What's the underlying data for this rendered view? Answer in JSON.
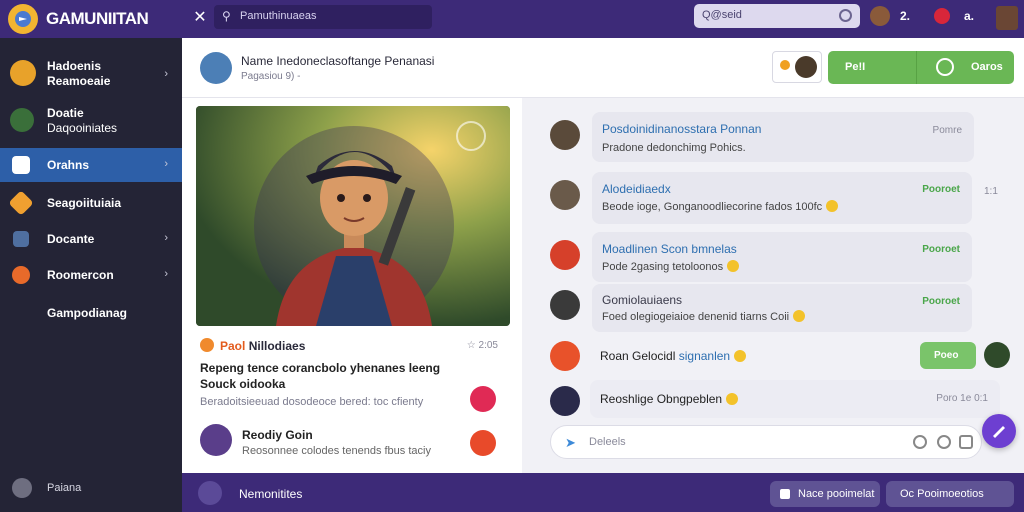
{
  "topbar": {
    "app_name": "GAMUNIITAN",
    "search_placeholder": "Pamuthinuaeas",
    "search2_text": "Q@seid",
    "user_count": "2.",
    "user_initial": "a."
  },
  "sidebar": {
    "items": [
      {
        "line1": "Hadoenis",
        "line2": "Reamoeaie",
        "chevron": "›"
      },
      {
        "line1": "Doatie",
        "line2": "Daqooiniates"
      },
      {
        "line1": "Orahns",
        "chevron": "›"
      },
      {
        "line1": "Seagoiituiaia"
      },
      {
        "line1": "Docante",
        "chevron": "›"
      },
      {
        "line1": "Roomercon",
        "chevron": "›"
      },
      {
        "line1": "Gampodianag"
      }
    ],
    "footer": "Paiana"
  },
  "header": {
    "title": "Name Inedoneclasoftange Penanasi",
    "subtitle": "Pagasiou 9) -",
    "green_btn_left": "Pe!I",
    "green_btn_right": "Oaros"
  },
  "post": {
    "tag_prefix": "Paol",
    "tag_name": "Nillodiaes",
    "time": "2:05",
    "body": "Repeng tence corancbolo yhenanes leeng Souck oidooka",
    "meta": "Beradoitsieeuad dosodeoce bered: toc cfienty",
    "user_name": "Reodiy Goin",
    "user_sub": "Reosonnee colodes tenends fbus taciy"
  },
  "chat": {
    "messages": [
      {
        "name": "Posdoinidinanosstara Ponnan",
        "text": "Pradone dedonchimg  Pohics.",
        "time": "Pomre"
      },
      {
        "name": "Alodeidiaedx",
        "text": "Beode ioge, Gonganoodliecorine fados 100fc",
        "tag": "Pooroet",
        "time": "1:1"
      },
      {
        "name": "Moadlinen Scon bmnelas",
        "text": "Pode 2gasing tetoloonos",
        "tag": "Pooroet"
      },
      {
        "name": "Gomiolauiaens",
        "text": "Foed olegiogeiaioe denenid tiarns Coii",
        "tag": "Pooroet"
      }
    ],
    "plain1": {
      "prefix": "Roan",
      "mid": "Gelocidl",
      "highlight": "signanlen"
    },
    "green_pill": "Poeo",
    "plain2": {
      "text": "Reoshlige Obngpeblen",
      "time": "Poro 1e 0:1"
    },
    "compose_placeholder": "Deleels"
  },
  "bottombar": {
    "label": "Nemonitites",
    "btn1": "Nace pooimelat",
    "btn2": "Oc Pooimoeotios"
  },
  "colors": {
    "topbar": "#3d2a78",
    "sidebar": "#242436",
    "active": "#2d5fa8",
    "accent_green": "#6ab755",
    "accent_purple": "#6d3fd1"
  }
}
